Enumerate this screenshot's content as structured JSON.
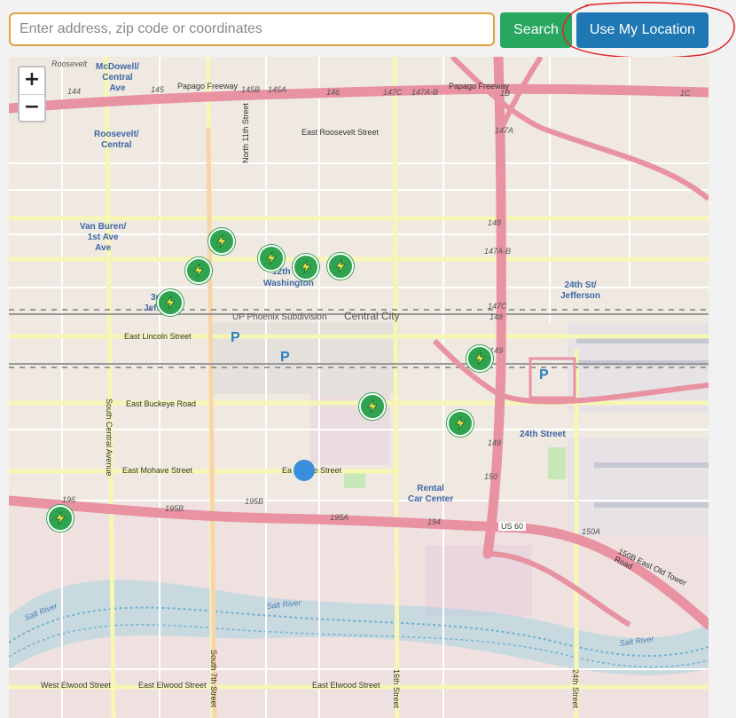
{
  "search": {
    "placeholder": "Enter address, zip code or coordinates",
    "value": "",
    "search_label": "Search",
    "location_label": "Use My Location"
  },
  "map": {
    "zoom_in": "+",
    "zoom_out": "−",
    "labels": {
      "roosevelt_top": "Roosevelt",
      "mcdowell_central": "McDowell/",
      "mcdowell_central2": "Central",
      "mcdowell_central3": "Ave",
      "roosevelt_central": "Roosevelt/",
      "roosevelt_central2": "Central",
      "papago": "Papago Freeway",
      "papago2": "Papago Freeway",
      "east_roosevelt": "East Roosevelt Street",
      "north_11th": "North 11th Street",
      "van_buren": "Van Buren/",
      "van_buren2": "1st Ave",
      "van_buren3": "Ave",
      "twelfth": "12th",
      "washington": "Washington",
      "third": "3r",
      "jeff": "Jeffe",
      "up_phoenix": "UP Phoenix Subdivision",
      "central_city": "Central City",
      "east_lincoln": "East Lincoln Street",
      "east_buckeye": "East Buckeye Road",
      "south_central": "South Central Avenue",
      "east_mohave": "East Mohave Street",
      "mohave2": "Ea      ave Street",
      "rental": "Rental",
      "rental2": "Car Center",
      "twentyfourth_jeff": "24th St/",
      "twentyfourth_jeff2": "Jefferson",
      "twentyfourth_street": "24th Street",
      "us60": "US 60",
      "east_loop": "150B East Old Tower Road",
      "salt_river_a": "Salt River",
      "salt_river_b": "Salt River",
      "salt_river_c": "Salt River",
      "west_elwood": "West Elwood Street",
      "east_elwood_a": "East Elwood Street",
      "east_elwood_b": "East Elwood Street",
      "south_7th": "South 7th Street",
      "sixteenth": "16th Street",
      "twentyfourth_s": "24th Street",
      "p1": "P",
      "p2": "P",
      "p3": "P",
      "e144": "144",
      "e145": "145",
      "e145b": "145B",
      "e145a": "145A",
      "e146": "146",
      "e147c": "147C",
      "e147ab": "147A-B",
      "e1b": "1B",
      "e1c": "1C",
      "e147a": "147A",
      "e148": "148",
      "e147ab2": "147A-B",
      "e147c2": "147C",
      "e148b": "148",
      "e149": "149",
      "e149b": "149",
      "e150": "150",
      "e150a": "150A",
      "e196": "196",
      "e195b": "195B",
      "e195b2": "195B",
      "e195a": "195A",
      "e194": "194"
    },
    "accent_colors": {
      "freeway": "#e892a2",
      "major_road": "#f7fabf",
      "river": "#aad3df",
      "charger": "#2fa34f",
      "location_dot": "#3a8fdc"
    }
  }
}
